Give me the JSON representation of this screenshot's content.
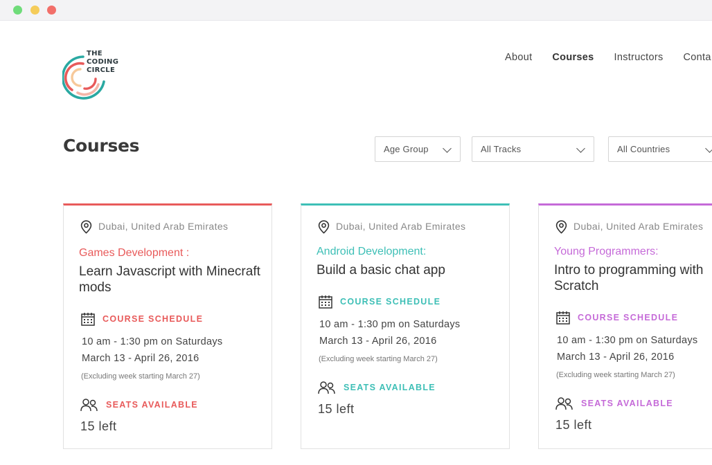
{
  "window": {
    "buttons": [
      "close",
      "minimize",
      "maximize"
    ]
  },
  "logo": {
    "lines": [
      "THE",
      "CODING",
      "CIRCLE"
    ]
  },
  "nav": {
    "items": [
      "About",
      "Courses",
      "Instructors",
      "Conta"
    ],
    "active": "Courses"
  },
  "page": {
    "heading": "Courses"
  },
  "filters": {
    "age": "Age Group",
    "tracks": "All Tracks",
    "countries": "All Countries"
  },
  "accent_colors": {
    "red": "#e85a5a",
    "teal": "#3dbfb6",
    "purple": "#c56ad8"
  },
  "cards": [
    {
      "location": "Dubai, United Arab Emirates",
      "track": "Games Development :",
      "title": "Learn Javascript with Minecraft mods",
      "schedule_label": "COURSE SCHEDULE",
      "time": "10 am - 1:30 pm on Saturdays",
      "dates": "March 13 - April 26, 2016",
      "exclusion": "(Excluding week starting March 27)",
      "seats_label": "SEATS AVAILABLE",
      "seats_left": "15 left"
    },
    {
      "location": "Dubai, United Arab Emirates",
      "track": "Android Development:",
      "title": "Build a basic chat app",
      "schedule_label": "COURSE SCHEDULE",
      "time": "10 am - 1:30 pm on Saturdays",
      "dates": "March 13 - April 26, 2016",
      "exclusion": "(Excluding week starting March 27)",
      "seats_label": "SEATS AVAILABLE",
      "seats_left": "15 left"
    },
    {
      "location": "Dubai, United Arab Emirates",
      "track": "Young Programmers:",
      "title": "Intro to programming with Scratch",
      "schedule_label": "COURSE SCHEDULE",
      "time": "10 am - 1:30 pm on Saturdays",
      "dates": "March 13 - April 26, 2016",
      "exclusion": "(Excluding week starting March 27)",
      "seats_label": "SEATS AVAILABLE",
      "seats_left": "15 left"
    }
  ]
}
